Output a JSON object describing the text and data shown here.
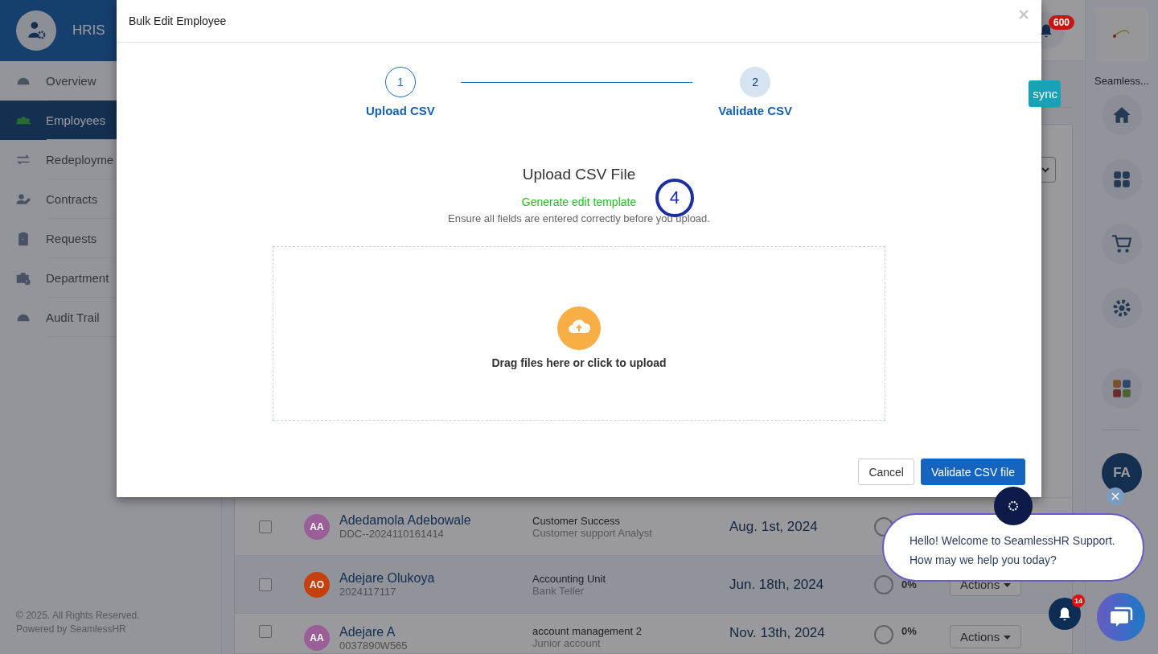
{
  "app": {
    "title": "HRIS"
  },
  "sidebar": {
    "items": [
      {
        "label": "Overview",
        "selected": false
      },
      {
        "label": "Employees",
        "selected": true
      },
      {
        "label": "Redeployme",
        "selected": false
      },
      {
        "label": "Contracts",
        "selected": false
      },
      {
        "label": "Requests",
        "selected": false
      },
      {
        "label": "Department",
        "selected": false
      },
      {
        "label": "Audit Trail",
        "selected": false
      }
    ],
    "footer": [
      "© 2025. All Rights Reserved.",
      "Powered by SeamlessHR"
    ]
  },
  "topbar": {
    "notification_count": "600",
    "sync_button": "sync"
  },
  "rail": {
    "brand": "Seamless...",
    "user_initials": "FA"
  },
  "table": {
    "rows": [
      {
        "checked": false,
        "avatar": "AA",
        "color": "#9b5f98",
        "name": "Adedamola Adebowale",
        "id": "DDC--2024110161414",
        "department": "Customer Success",
        "role": "Customer support Analyst",
        "date": "Aug. 1st, 2024"
      },
      {
        "checked": false,
        "avatar": "AO",
        "color": "#c4400c",
        "name": "Adejare Olukoya",
        "id": "2024117117",
        "department": "Accounting Unit",
        "role": "Bank Teller",
        "date": "Jun. 18th, 2024",
        "progress": "0%",
        "actions": "Actions"
      },
      {
        "checked": false,
        "avatar": "AA",
        "color": "#9b5f98",
        "name": "Adejare A",
        "id": "0037890W565",
        "department": "account management 2",
        "role": "Junior account",
        "date": "Nov. 13th, 2024",
        "progress": "0%",
        "actions": "Actions"
      }
    ]
  },
  "modal": {
    "title": "Bulk Edit Employee",
    "steps": [
      {
        "number": "1",
        "label": "Upload CSV",
        "current": true
      },
      {
        "number": "2",
        "label": "Validate CSV",
        "current": false
      }
    ],
    "heading": "Upload CSV File",
    "template_link": "Generate edit template",
    "hint": "Ensure all fields are entered correctly before you upload.",
    "dropzone": "Drag files here or click to upload",
    "buttons": [
      {
        "label": "Cancel",
        "kind": "secondary"
      },
      {
        "label": "Validate CSV file",
        "kind": "primary"
      }
    ]
  },
  "annotation": {
    "marker": "4"
  },
  "chat": {
    "message": "Hello! Welcome to SeamlessHR Support. How may we help you today?",
    "notification_count": "14"
  }
}
